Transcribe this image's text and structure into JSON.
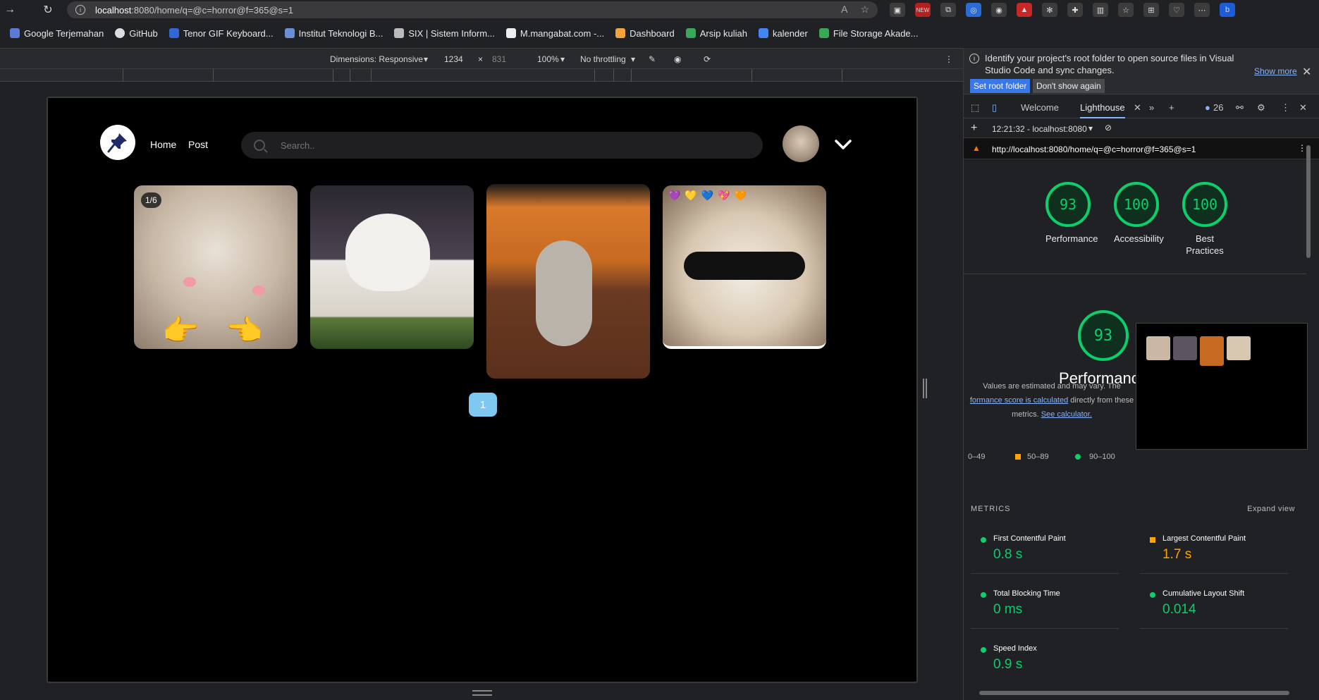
{
  "browser": {
    "url_host": "localhost",
    "url_rest": ":8080/home/q=@c=horror@f=365@s=1",
    "extension_badge": "NEW"
  },
  "bookmarks": [
    {
      "label": "Google Terjemahan"
    },
    {
      "label": "GitHub"
    },
    {
      "label": "Tenor GIF Keyboard..."
    },
    {
      "label": "Institut Teknologi B..."
    },
    {
      "label": "SIX | Sistem Inform..."
    },
    {
      "label": "M.mangabat.com -..."
    },
    {
      "label": "Dashboard"
    },
    {
      "label": "Arsip kuliah"
    },
    {
      "label": "kalender"
    },
    {
      "label": "File Storage Akade..."
    }
  ],
  "device_toolbar": {
    "dimensions": "Dimensions: Responsive",
    "width": "1234",
    "times": "×",
    "height": "831",
    "zoom": "100%",
    "throttle": "No throttling"
  },
  "site": {
    "nav": [
      "Home",
      "Post"
    ],
    "search_placeholder": "Search..",
    "carousel_badge": "1/6",
    "page_number": "1"
  },
  "devtools": {
    "info_message": "Identify your project's root folder to open source files in Visual Studio Code and sync changes.",
    "show_more": "Show more",
    "set_root": "Set root folder",
    "dont_show": "Don't show again",
    "tabs": [
      "Welcome",
      "Lighthouse"
    ],
    "issue_count": "26",
    "report_time": "12:21:32 - localhost:8080",
    "report_url": "http://localhost:8080/home/q=@c=horror@f=365@s=1",
    "scores": [
      {
        "value": "93",
        "label": "Performance"
      },
      {
        "value": "100",
        "label": "Accessibility"
      },
      {
        "value": "100",
        "label": "Best Practices"
      }
    ],
    "perf_score": "93",
    "perf_title": "Performance",
    "perf_note_1": "Values are estimated and may vary. The",
    "perf_link_1": "formance score is calculated",
    "perf_note_2": "directly from these",
    "perf_note_3": "metrics.",
    "perf_link_2": "See calculator.",
    "legend": [
      "0–49",
      "50–89",
      "90–100"
    ],
    "metrics_header": "METRICS",
    "expand_view": "Expand view",
    "metrics": [
      {
        "name": "First Contentful Paint",
        "value": "0.8 s",
        "status": "good"
      },
      {
        "name": "Largest Contentful Paint",
        "value": "1.7 s",
        "status": "average"
      },
      {
        "name": "Total Blocking Time",
        "value": "0 ms",
        "status": "good"
      },
      {
        "name": "Cumulative Layout Shift",
        "value": "0.014",
        "status": "good"
      },
      {
        "name": "Speed Index",
        "value": "0.9 s",
        "status": "good"
      }
    ],
    "colors": {
      "good": "#0cce6b",
      "average": "#ffa400",
      "poor": "#ff4e42"
    }
  }
}
